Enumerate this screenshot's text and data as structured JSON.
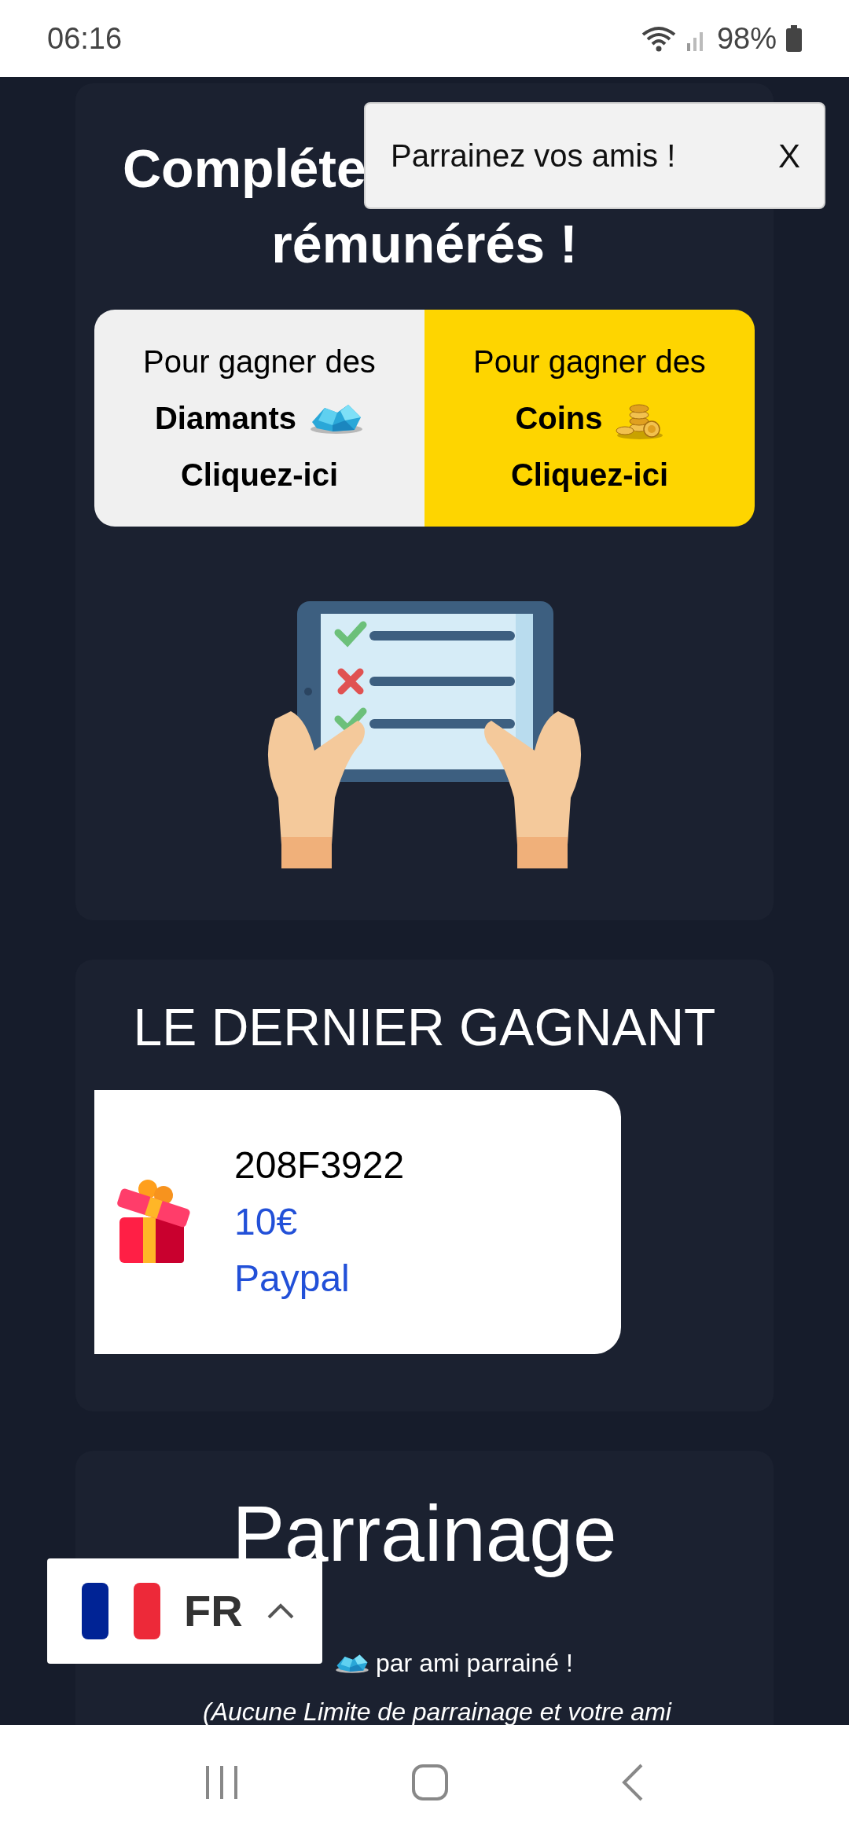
{
  "status_bar": {
    "time": "06:16",
    "battery": "98%"
  },
  "toast": {
    "text": "Parrainez vos amis !",
    "close": "X"
  },
  "tasks_card": {
    "title_lines": [
      "Compléte",
      "rémunérés !"
    ],
    "options": [
      {
        "kind": "diamonds",
        "line1": "Pour gagner des",
        "currency": "Diamants",
        "action": "Cliquez-ici"
      },
      {
        "kind": "coins",
        "line1": "Pour gagner des",
        "currency": "Coins",
        "action": "Cliquez-ici"
      }
    ]
  },
  "winner_card": {
    "title": "LE DERNIER GAGNANT",
    "winner": {
      "id": "208F3922",
      "amount": "10€",
      "method": "Paypal"
    }
  },
  "referral": {
    "title": "Parrainage",
    "reward_text": "par ami parrainé !",
    "note": "(Aucune Limite de parrainage et votre ami"
  },
  "language": {
    "code": "FR"
  }
}
